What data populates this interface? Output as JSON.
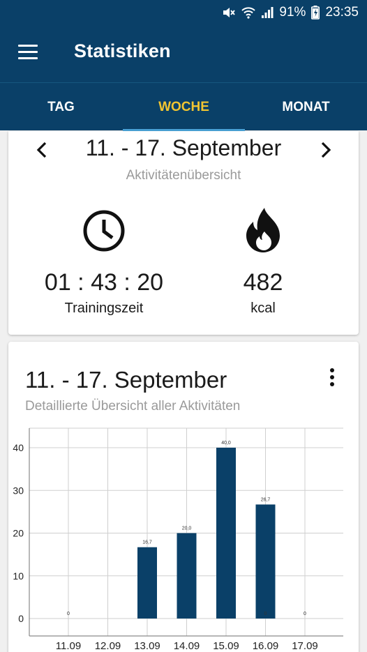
{
  "status_bar": {
    "battery": "91%",
    "time": "23:35",
    "icons": [
      "mute-icon",
      "wifi-icon",
      "signal-icon",
      "battery-icon"
    ]
  },
  "app_bar": {
    "title": "Statistiken",
    "menu_icon": "hamburger-menu-icon"
  },
  "tabs": [
    {
      "label": "TAG",
      "active": false
    },
    {
      "label": "WOCHE",
      "active": true
    },
    {
      "label": "MONAT",
      "active": false
    }
  ],
  "overview": {
    "week": "11. - 17. September",
    "subtitle": "Aktivitätenübersicht",
    "time_value": "01 : 43 : 20",
    "time_label": "Trainingszeit",
    "time_icon": "clock-icon",
    "kcal_value": "482",
    "kcal_label": "kcal",
    "kcal_icon": "flame-icon"
  },
  "detail": {
    "week": "11. - 17. September",
    "subtitle": "Detaillierte Übersicht aller Aktivitäten",
    "menu_icon": "more-vert-icon"
  },
  "colors": {
    "primary": "#0a4068",
    "accent": "#f2c531",
    "indicator": "#4aa3d8",
    "bar": "#0a4068"
  },
  "chart_data": {
    "type": "bar",
    "categories": [
      "11.09",
      "12.09",
      "13.09",
      "14.09",
      "15.09",
      "16.09",
      "17.09"
    ],
    "values": [
      0,
      16.7,
      20.0,
      40.0,
      26.7,
      0,
      0
    ],
    "value_labels": [
      "0",
      "16,7",
      "20,0",
      "40,0",
      "26,7",
      "0",
      "0"
    ],
    "y_ticks": [
      0,
      10,
      20,
      30,
      40
    ],
    "ylim": [
      0,
      44
    ],
    "grid": true
  }
}
